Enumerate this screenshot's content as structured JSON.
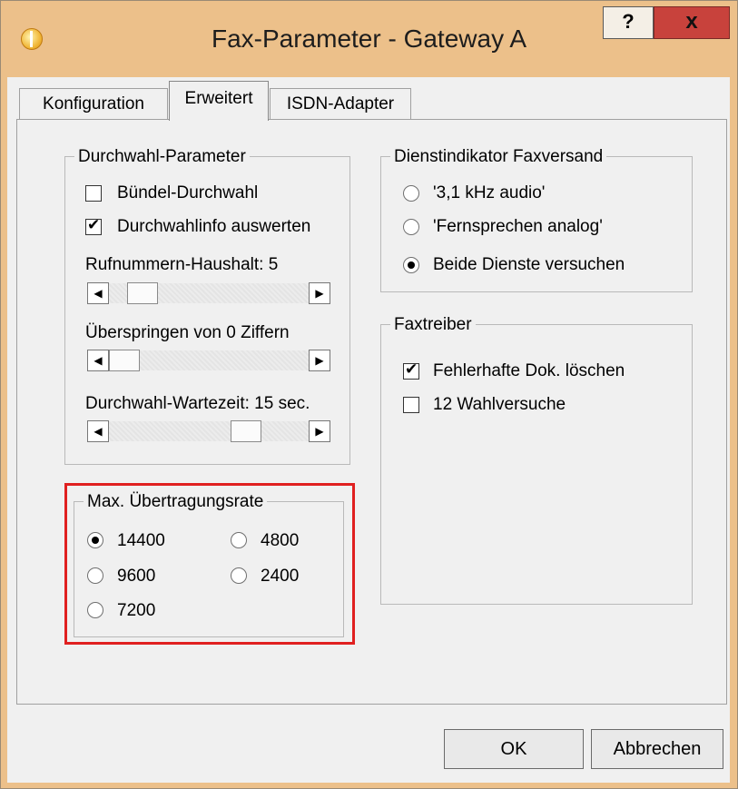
{
  "window": {
    "title": "Fax-Parameter - Gateway A",
    "help_label": "?",
    "close_label": "x"
  },
  "tabs": [
    {
      "label": "Konfiguration",
      "active": false
    },
    {
      "label": "Erweitert",
      "active": true
    },
    {
      "label": "ISDN-Adapter",
      "active": false
    }
  ],
  "durchwahl": {
    "group_label": "Durchwahl-Parameter",
    "buendel_label": "Bündel-Durchwahl",
    "buendel_checked": false,
    "info_label": "Durchwahlinfo auswerten",
    "info_checked": true,
    "rufnummern_label": "Rufnummern-Haushalt: 5",
    "rufnummern_value": 5,
    "ueberspringen_label": "Überspringen von 0 Ziffern",
    "ueberspringen_value": 0,
    "wartezeit_label": "Durchwahl-Wartezeit: 15 sec.",
    "wartezeit_value": 15,
    "scroll_left_glyph": "◀",
    "scroll_right_glyph": "▶"
  },
  "dienstindikator": {
    "group_label": "Dienstindikator Faxversand",
    "options": [
      {
        "label": "'3,1 kHz audio'",
        "selected": false
      },
      {
        "label": "'Fernsprechen analog'",
        "selected": false
      },
      {
        "label": "Beide Dienste versuchen",
        "selected": true
      }
    ]
  },
  "faxtreiber": {
    "group_label": "Faxtreiber",
    "fehlerhafte_label": "Fehlerhafte Dok. löschen",
    "fehlerhafte_checked": true,
    "wahlversuche_label": "12 Wahlversuche",
    "wahlversuche_checked": false
  },
  "uebertragungsrate": {
    "group_label": "Max. Übertragungsrate",
    "options": [
      {
        "label": "14400",
        "selected": true
      },
      {
        "label": "4800",
        "selected": false
      },
      {
        "label": "9600",
        "selected": false
      },
      {
        "label": "2400",
        "selected": false
      },
      {
        "label": "7200",
        "selected": false
      }
    ],
    "highlight_color": "#e02020"
  },
  "buttons": {
    "ok_label": "OK",
    "cancel_label": "Abbrechen"
  }
}
